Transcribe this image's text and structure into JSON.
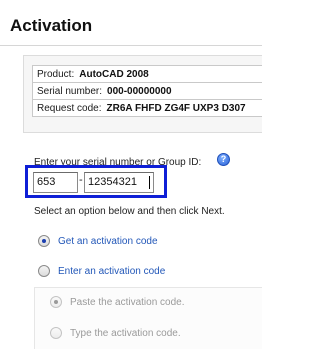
{
  "page": {
    "title": "Activation"
  },
  "product_info": {
    "rows": [
      {
        "label": "Product:",
        "value": "AutoCAD 2008"
      },
      {
        "label": "Serial number:",
        "value": "000-00000000"
      },
      {
        "label": "Request code:",
        "value": "ZR6A FHFD ZG4F UXP3 D307"
      }
    ]
  },
  "serial_entry": {
    "prompt": "Enter your serial number or Group ID:",
    "help_icon": "help-icon",
    "prefix_value": "653",
    "separator": "-",
    "number_value": "12354321"
  },
  "options": {
    "prompt": "Select an option below and then click Next.",
    "items": [
      {
        "label": "Get an activation code",
        "checked": true,
        "enabled": true
      },
      {
        "label": "Enter an activation code",
        "checked": false,
        "enabled": true
      },
      {
        "label": "Paste the activation code.",
        "checked": true,
        "enabled": false
      },
      {
        "label": "Type the activation code.",
        "checked": false,
        "enabled": false
      }
    ]
  },
  "colors": {
    "highlight_border": "#0e1fd6",
    "link_blue": "#2257b8",
    "disabled_gray": "#9a9a9a"
  }
}
